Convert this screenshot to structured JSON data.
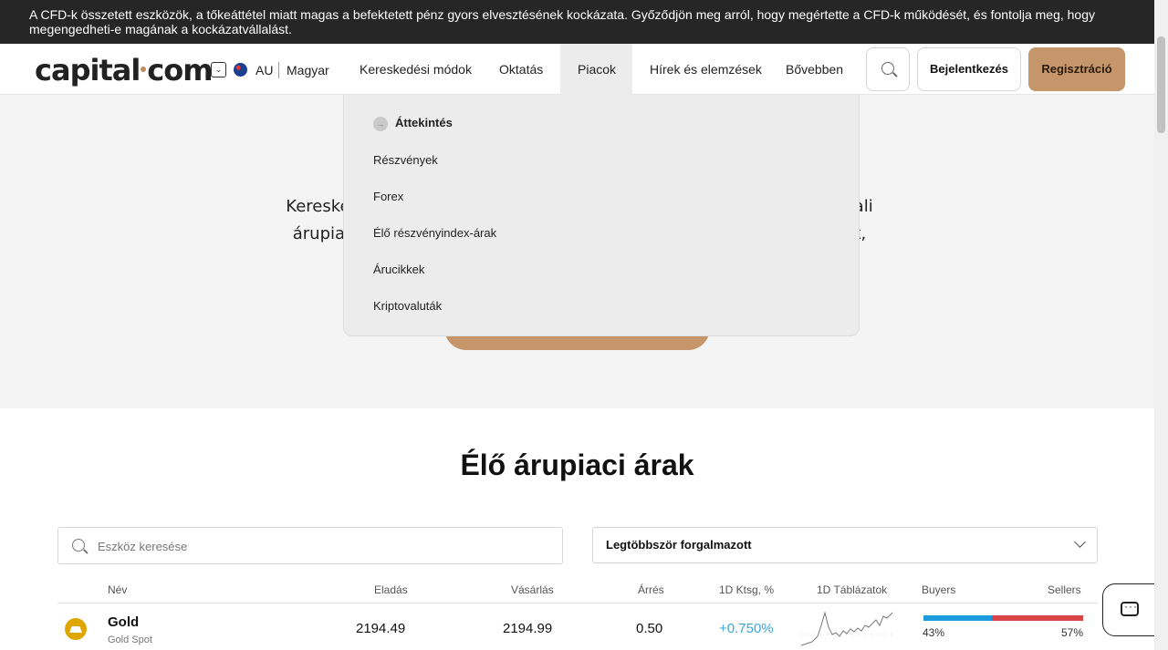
{
  "risk_banner": {
    "text": "A CFD-k összetett eszközök, a tőkeáttétel miatt magas a befektetett pénz gyors elvesztésének kockázata. Győződjön meg arról, hogy megértette a CFD-k működését, és fontolja meg, hogy megengedheti-e magának a kockázatvállalást."
  },
  "header": {
    "logo_left": "capital",
    "logo_right": "com",
    "region": "AU",
    "language": "Magyar",
    "nav": {
      "trading": "Kereskedési módok",
      "education": "Oktatás",
      "markets": "Piacok",
      "news": "Hírek és elemzések",
      "more": "Bővebben"
    },
    "login": "Bejelentkezés",
    "register": "Regisztráció",
    "icons": [
      "chevron-down-icon",
      "australia-flag-icon",
      "search-icon"
    ]
  },
  "hero": {
    "line1": "Kereskedjen az ege                                                              ztül azonnali",
    "line2": "árupiaci árak érhe                                                              almasságot,"
  },
  "markets_menu": {
    "overview": "Áttekintés",
    "items": [
      "Részvények",
      "Forex",
      "Élő részvényindex-árak",
      "Árucikkek",
      "Kriptovaluták"
    ]
  },
  "prices": {
    "title": "Élő árupiaci árak",
    "search_placeholder": "Eszköz keresése",
    "sort": "Legtöbbször forgalmazott",
    "columns": {
      "name": "Név",
      "sell": "Eladás",
      "buy": "Vásárlás",
      "spread": "Árrés",
      "change": "1D Ktsg, %",
      "chart": "1D Táblázatok",
      "buyers": "Buyers",
      "sellers": "Sellers"
    },
    "rows": [
      {
        "name": "Gold",
        "subtitle": "Gold Spot",
        "sell": "2194.49",
        "buy": "2194.99",
        "spread": "0.50",
        "change": "+0.750%",
        "buyers_pct": "43%",
        "sellers_pct": "57%",
        "buyers_share": 0.43
      }
    ]
  },
  "colors": {
    "accent": "#c49669",
    "banner_bg": "#262626",
    "positive": "#3ba6d8",
    "buyers_bar": "#1d9bdc",
    "sellers_bar": "#d94447"
  }
}
